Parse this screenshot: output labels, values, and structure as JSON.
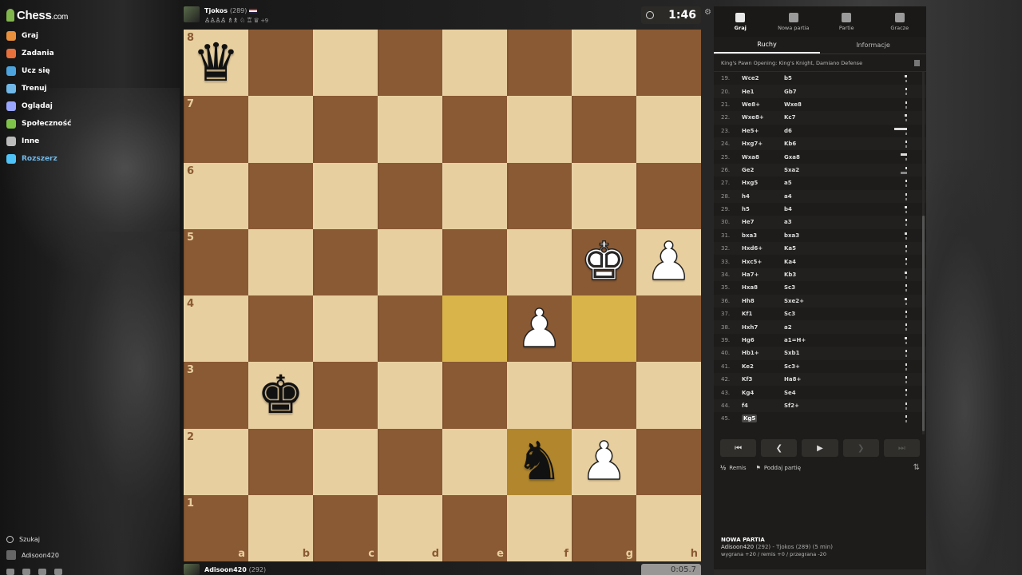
{
  "brand": {
    "name": "Chess",
    "suffix": ".com"
  },
  "nav": [
    {
      "label": "Graj",
      "icon": "play-icon",
      "color": "#e8903c"
    },
    {
      "label": "Zadania",
      "icon": "puzzle-icon",
      "color": "#e8703c"
    },
    {
      "label": "Ucz się",
      "icon": "learn-icon",
      "color": "#4ca3dd"
    },
    {
      "label": "Trenuj",
      "icon": "train-icon",
      "color": "#6fb8e8"
    },
    {
      "label": "Oglądaj",
      "icon": "watch-icon",
      "color": "#9aa7ff"
    },
    {
      "label": "Społeczność",
      "icon": "community-icon",
      "color": "#7fc24a"
    },
    {
      "label": "Inne",
      "icon": "more-icon",
      "color": "#bbbbbb"
    },
    {
      "label": "Rozszerz",
      "icon": "diamond-icon",
      "color": "#4fc3f7"
    }
  ],
  "sidebar_bottom": {
    "search_label": "Szukaj",
    "user_label": "Adisoon420"
  },
  "top_player": {
    "name": "Tjokos",
    "rating": "(289)",
    "captured": "♙♙♙♙ ♗♗ ♘ ♖ ♕",
    "captured_extra": "+9",
    "clock": "1:46"
  },
  "bottom_player": {
    "name": "Adisoon420",
    "rating": "(292)",
    "clock": "0:05.7"
  },
  "board": {
    "ranks": [
      "8",
      "7",
      "6",
      "5",
      "4",
      "3",
      "2",
      "1"
    ],
    "files": [
      "a",
      "b",
      "c",
      "d",
      "e",
      "f",
      "g",
      "h"
    ],
    "pieces": {
      "a8": {
        "glyph": "♛",
        "color": "black"
      },
      "g5": {
        "glyph": "♚",
        "color": "white"
      },
      "h5": {
        "glyph": "♟",
        "color": "white"
      },
      "f4": {
        "glyph": "♟",
        "color": "white"
      },
      "b3": {
        "glyph": "♚",
        "color": "black"
      },
      "f2": {
        "glyph": "♞",
        "color": "black"
      },
      "g2": {
        "glyph": "♟",
        "color": "white"
      }
    },
    "highlights": [
      "e4",
      "g4",
      "f2"
    ]
  },
  "panel": {
    "tabs": [
      {
        "label": "Graj",
        "icon": "lightning-icon",
        "active": true
      },
      {
        "label": "Nowa partia",
        "icon": "plus-square-icon",
        "active": false
      },
      {
        "label": "Partie",
        "icon": "games-icon",
        "active": false
      },
      {
        "label": "Gracze",
        "icon": "players-icon",
        "active": false
      }
    ],
    "subtabs": [
      "Ruchy",
      "Informacje"
    ],
    "opening": "King's Pawn Opening: King's Knight, Damiano Defense",
    "moves": [
      {
        "n": "19.",
        "w": "Wce2",
        "b": "b5"
      },
      {
        "n": "20.",
        "w": "He1",
        "b": "Gb7"
      },
      {
        "n": "21.",
        "w": "We8+",
        "b": "Wxe8"
      },
      {
        "n": "22.",
        "w": "Wxe8+",
        "b": "Kc7"
      },
      {
        "n": "23.",
        "w": "He5+",
        "b": "d6"
      },
      {
        "n": "24.",
        "w": "Hxg7+",
        "b": "Kb6"
      },
      {
        "n": "25.",
        "w": "Wxa8",
        "b": "Gxa8"
      },
      {
        "n": "26.",
        "w": "Ge2",
        "b": "Sxa2"
      },
      {
        "n": "27.",
        "w": "Hxg5",
        "b": "a5"
      },
      {
        "n": "28.",
        "w": "h4",
        "b": "a4"
      },
      {
        "n": "29.",
        "w": "h5",
        "b": "b4"
      },
      {
        "n": "30.",
        "w": "He7",
        "b": "a3"
      },
      {
        "n": "31.",
        "w": "bxa3",
        "b": "bxa3"
      },
      {
        "n": "32.",
        "w": "Hxd6+",
        "b": "Ka5"
      },
      {
        "n": "33.",
        "w": "Hxc5+",
        "b": "Ka4"
      },
      {
        "n": "34.",
        "w": "Ha7+",
        "b": "Kb3"
      },
      {
        "n": "35.",
        "w": "Hxa8",
        "b": "Sc3"
      },
      {
        "n": "36.",
        "w": "Hh8",
        "b": "Sxe2+"
      },
      {
        "n": "37.",
        "w": "Kf1",
        "b": "Sc3"
      },
      {
        "n": "38.",
        "w": "Hxh7",
        "b": "a2"
      },
      {
        "n": "39.",
        "w": "Hg6",
        "b": "a1=H+"
      },
      {
        "n": "40.",
        "w": "Hb1+",
        "b": "Sxb1"
      },
      {
        "n": "41.",
        "w": "Ke2",
        "b": "Sc3+"
      },
      {
        "n": "42.",
        "w": "Kf3",
        "b": "Ha8+"
      },
      {
        "n": "43.",
        "w": "Kg4",
        "b": "Se4"
      },
      {
        "n": "44.",
        "w": "f4",
        "b": "Sf2+"
      },
      {
        "n": "45.",
        "w": "Kg5",
        "b": ""
      }
    ],
    "actions": {
      "draw": "Remis",
      "resign": "Poddaj partię"
    },
    "new_game": {
      "title": "NOWA PARTIA",
      "players": "Adisoon420",
      "players_rest": "(292) - Tjokos (289) (5 min)",
      "result": "wygrana +20 / remis +0 / przegrana -20"
    }
  }
}
